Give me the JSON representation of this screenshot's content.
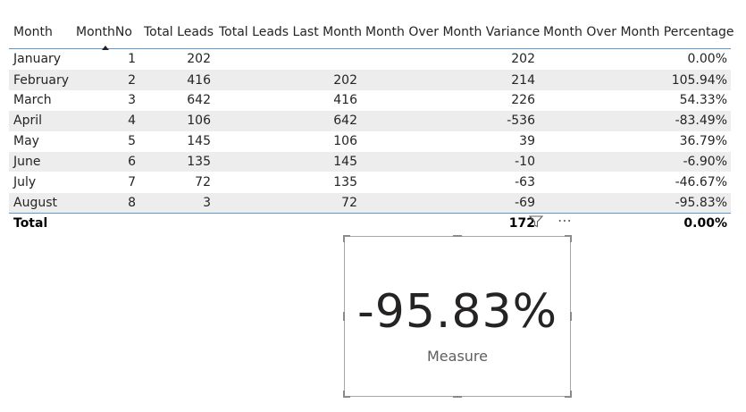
{
  "table": {
    "headers": {
      "month": "Month",
      "monthno": "MonthNo",
      "total_leads": "Total Leads",
      "last_month": "Total Leads Last Month",
      "variance": "Month Over Month Variance",
      "percentage": "Month Over Month Percentage"
    },
    "rows": [
      {
        "month": "January",
        "monthno": "1",
        "total_leads": "202",
        "last_month": "",
        "variance": "202",
        "percentage": "0.00%"
      },
      {
        "month": "February",
        "monthno": "2",
        "total_leads": "416",
        "last_month": "202",
        "variance": "214",
        "percentage": "105.94%"
      },
      {
        "month": "March",
        "monthno": "3",
        "total_leads": "642",
        "last_month": "416",
        "variance": "226",
        "percentage": "54.33%"
      },
      {
        "month": "April",
        "monthno": "4",
        "total_leads": "106",
        "last_month": "642",
        "variance": "-536",
        "percentage": "-83.49%"
      },
      {
        "month": "May",
        "monthno": "5",
        "total_leads": "145",
        "last_month": "106",
        "variance": "39",
        "percentage": "36.79%"
      },
      {
        "month": "June",
        "monthno": "6",
        "total_leads": "135",
        "last_month": "145",
        "variance": "-10",
        "percentage": "-6.90%"
      },
      {
        "month": "July",
        "monthno": "7",
        "total_leads": "72",
        "last_month": "135",
        "variance": "-63",
        "percentage": "-46.67%"
      },
      {
        "month": "August",
        "monthno": "8",
        "total_leads": "3",
        "last_month": "72",
        "variance": "-69",
        "percentage": "-95.83%"
      }
    ],
    "total": {
      "label": "Total",
      "variance": "172",
      "percentage": "0.00%"
    }
  },
  "visual_header": {
    "filter_icon": "filter-icon",
    "more_icon": "more-options-icon",
    "more_glyph": "⋯"
  },
  "card": {
    "value": "-95.83%",
    "label": "Measure"
  },
  "colors": {
    "accent_border": "#5b9bd5",
    "stripe": "#ededed"
  }
}
